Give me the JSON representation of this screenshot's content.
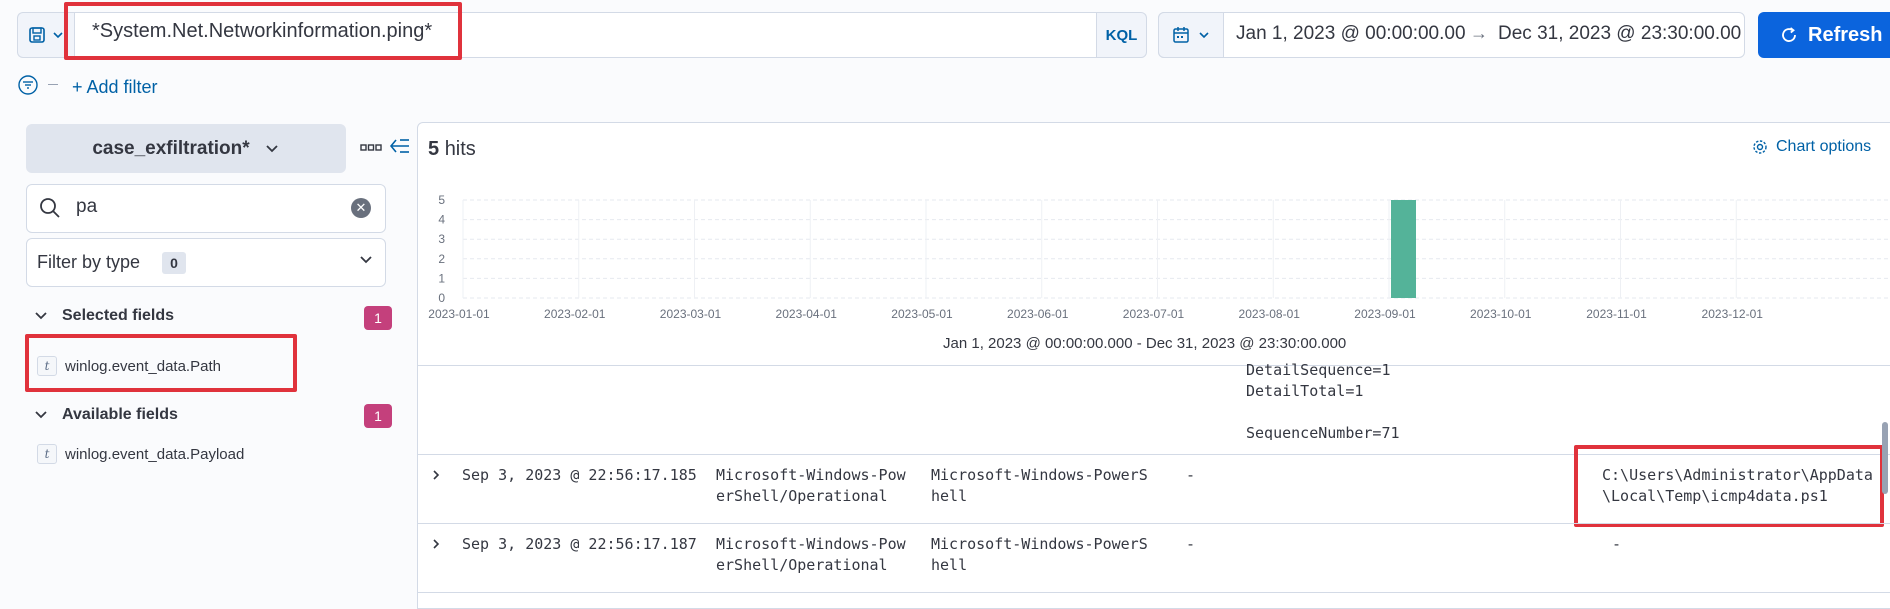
{
  "query": {
    "text": "*System.Net.Networkinformation.ping*",
    "language": "KQL"
  },
  "time_range": {
    "start": "Jan 1, 2023 @ 00:00:00.00",
    "end": "Dec 31, 2023 @ 23:30:00.00"
  },
  "refresh_label": "Refresh",
  "add_filter_label": "+ Add filter",
  "sidebar": {
    "index_pattern": "case_exfiltration*",
    "search_value": "pa",
    "filter_by_type_label": "Filter by type",
    "filter_by_type_count": "0",
    "selected_fields_title": "Selected fields",
    "selected_fields_count": "1",
    "selected_fields": [
      {
        "type": "t",
        "name": "winlog.event_data.Path"
      }
    ],
    "available_fields_title": "Available fields",
    "available_fields_count": "1",
    "available_fields": [
      {
        "type": "t",
        "name": "winlog.event_data.Payload"
      }
    ]
  },
  "hits": {
    "count": "5",
    "label": "hits"
  },
  "chart_options_label": "Chart options",
  "chart_data": {
    "type": "bar",
    "x": [
      "2023-01-01",
      "2023-02-01",
      "2023-03-01",
      "2023-04-01",
      "2023-05-01",
      "2023-06-01",
      "2023-07-01",
      "2023-08-01",
      "2023-09-01",
      "2023-10-01",
      "2023-11-01",
      "2023-12-01"
    ],
    "bars": [
      {
        "x": "2023-09-01",
        "value": 5
      }
    ],
    "yticks": [
      "0",
      "1",
      "2",
      "3",
      "4",
      "5"
    ],
    "ylim": [
      0,
      5
    ],
    "bar_color": "#54b399",
    "range_label": "Jan 1, 2023 @ 00:00:00.000 - Dec 31, 2023 @ 23:30:00.000"
  },
  "partial_doc_lines": [
    "DetailSequence=1",
    "DetailTotal=1",
    "",
    "SequenceNumber=71"
  ],
  "rows": [
    {
      "timestamp": "Sep 3, 2023 @ 22:56:17.185",
      "channel": "Microsoft-Windows-Pow\nerShell/Operational",
      "provider": "Microsoft-Windows-PowerS\nhell",
      "dash": "-",
      "path": "C:\\Users\\Administrator\\AppData\n\\Local\\Temp\\icmp4data.ps1"
    },
    {
      "timestamp": "Sep 3, 2023 @ 22:56:17.187",
      "channel": "Microsoft-Windows-Pow\nerShell/Operational",
      "provider": "Microsoft-Windows-PowerS\nhell",
      "dash": "-",
      "path": "-"
    }
  ]
}
